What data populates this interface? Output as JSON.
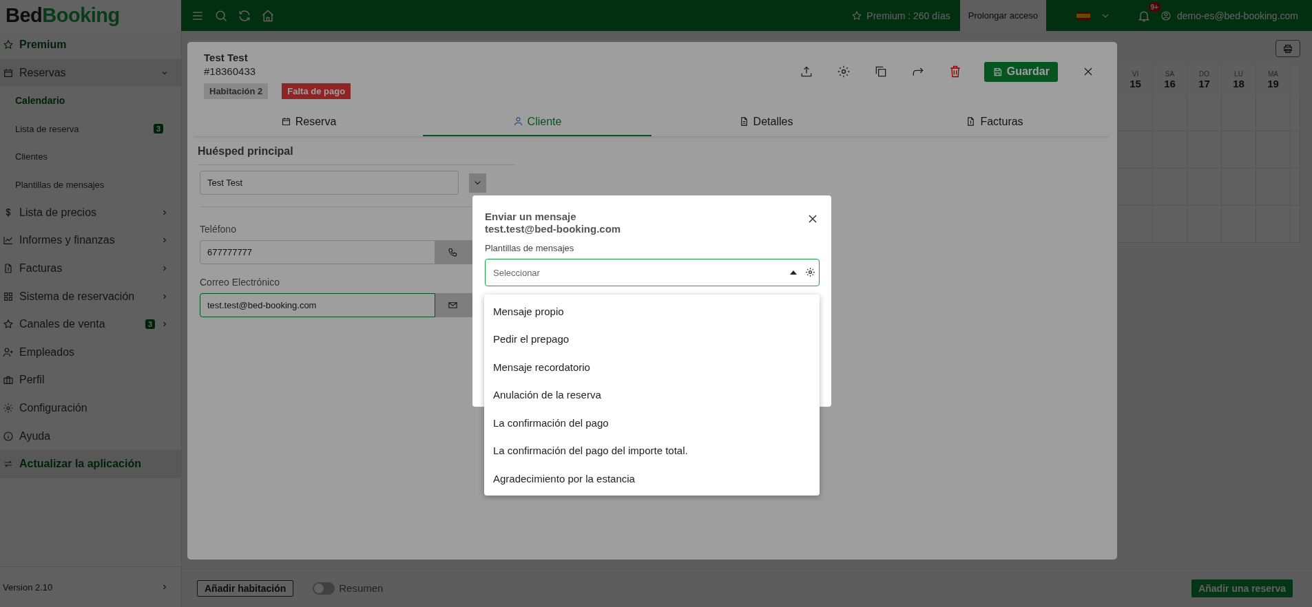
{
  "topbar": {
    "logo": {
      "first": "Bed",
      "second": "Booking"
    },
    "premium": "Premium : 260 días",
    "prolong_button": "Prolongar acceso",
    "notifications_badge": "9+",
    "user": "demo-es@bed-booking.com"
  },
  "sidebar": {
    "items": [
      {
        "label": "Premium",
        "kind": "highlight"
      },
      {
        "label": "Reservas",
        "kind": "group",
        "expanded": true,
        "children": [
          {
            "label": "Calendario",
            "selected": true
          },
          {
            "label": "Lista de reserva",
            "selected": false,
            "badge": "3"
          },
          {
            "label": "Clientes",
            "selected": false
          },
          {
            "label": "Plantillas de mensajes",
            "selected": false
          }
        ]
      },
      {
        "label": "Lista de precios",
        "kind": "group",
        "expanded": false
      },
      {
        "label": "Informes y finanzas",
        "kind": "group",
        "expanded": false
      },
      {
        "label": "Facturas",
        "kind": "group",
        "expanded": false
      },
      {
        "label": "Sistema de reservación",
        "kind": "group",
        "expanded": false
      },
      {
        "label": "Canales de venta",
        "kind": "group",
        "expanded": false,
        "badge": "3"
      },
      {
        "label": "Empleados",
        "kind": "link"
      },
      {
        "label": "Perfil",
        "kind": "link"
      },
      {
        "label": "Configuración",
        "kind": "link"
      },
      {
        "label": "Ayuda",
        "kind": "link"
      },
      {
        "label": "Actualizar la aplicación",
        "kind": "highlight"
      }
    ],
    "version": "Version 2.10"
  },
  "calendar": {
    "days": [
      {
        "weekday": "VI",
        "day": "15"
      },
      {
        "weekday": "SA",
        "day": "16"
      },
      {
        "weekday": "DO",
        "day": "17"
      },
      {
        "weekday": "LU",
        "day": "18"
      },
      {
        "weekday": "MA",
        "day": "19"
      }
    ]
  },
  "bottom_bar": {
    "add_room": "Añadir habitación",
    "summary": {
      "label": "Resumen",
      "on": false
    },
    "add_booking": "Añadir una reserva"
  },
  "booking_modal": {
    "guest_name": "Test Test",
    "booking_number": "#18360433",
    "tags": [
      {
        "label": "Habitación 2",
        "kind": "room"
      },
      {
        "label": "Falta de pago",
        "kind": "unpaid"
      }
    ],
    "save_button": "Guardar",
    "tabs": [
      {
        "label": "Reserva",
        "selected": false
      },
      {
        "label": "Cliente",
        "selected": true
      },
      {
        "label": "Detalles",
        "selected": false
      },
      {
        "label": "Facturas",
        "selected": false
      }
    ],
    "section_title": "Huésped principal",
    "guest_value": "Test Test",
    "phone": {
      "label": "Teléfono",
      "value": "677777777"
    },
    "email": {
      "label": "Correo Electrónico",
      "value": "test.test@bed-booking.com"
    }
  },
  "message_dialog": {
    "title": "Enviar un mensaje",
    "recipient": "test.test@bed-booking.com",
    "templates_label": "Plantillas de mensajes",
    "placeholder": "Seleccionar",
    "expanded": true,
    "options": [
      "Mensaje propio",
      "Pedir el prepago",
      "Mensaje recordatorio",
      "Anulación de la reserva",
      "La confirmación del pago",
      "La confirmación del pago del importe total.",
      "Agradecimiento por la estancia"
    ]
  }
}
